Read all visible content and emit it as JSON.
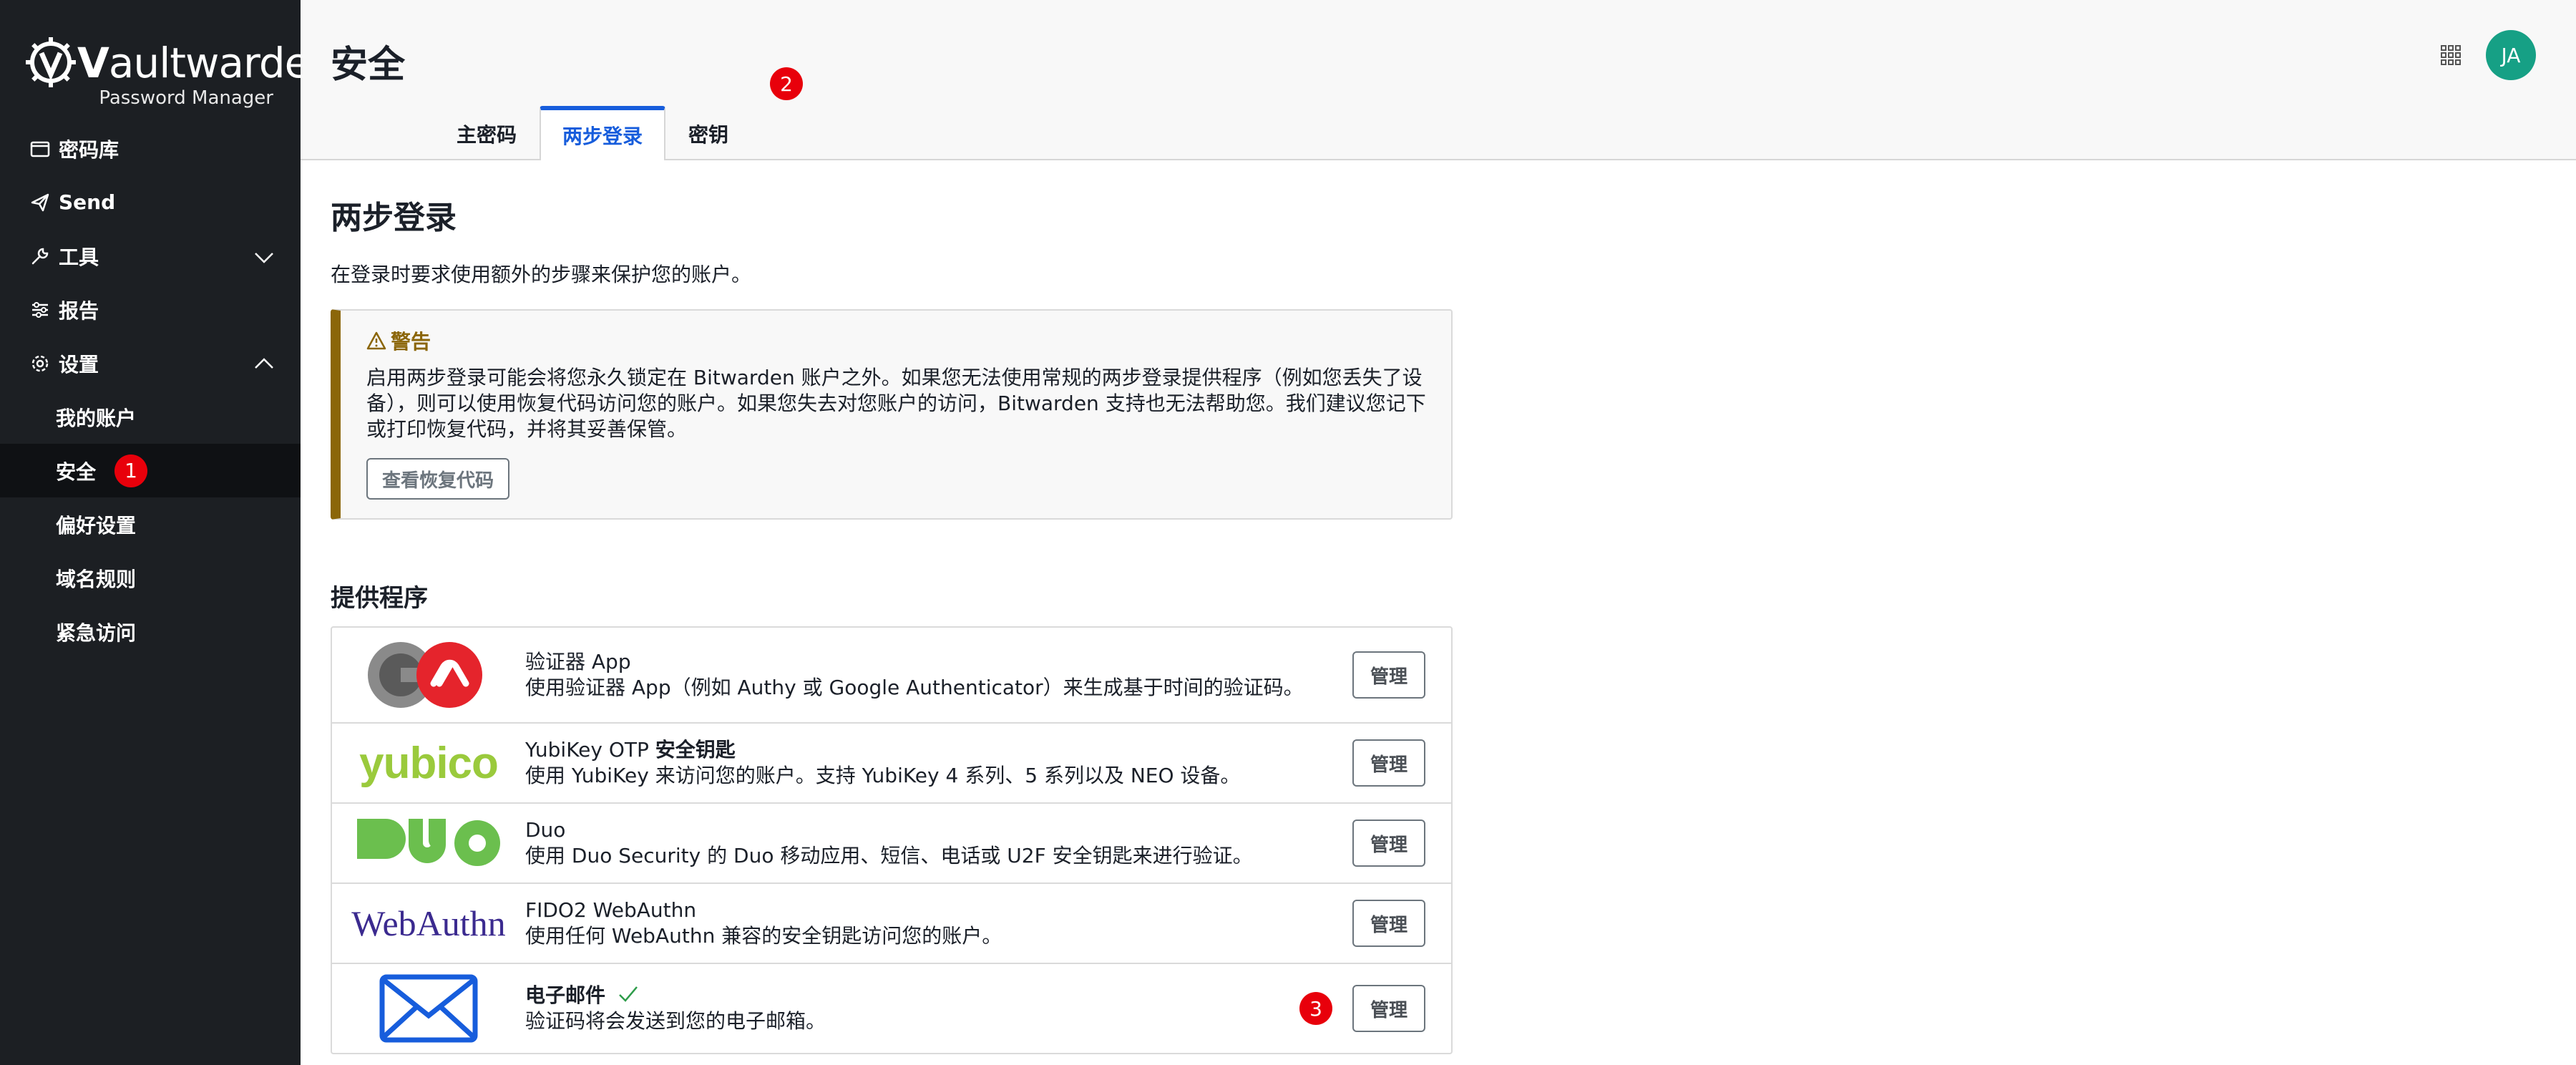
{
  "sidebar": {
    "brand": {
      "name_bold": "V",
      "name_rest": "aultwarden",
      "subtitle": "Password Manager"
    },
    "items": [
      {
        "label": "密码库",
        "icon": "vault-icon"
      },
      {
        "label": "Send",
        "icon": "send-icon"
      },
      {
        "label": "工具",
        "icon": "wrench-icon",
        "expanded": false
      },
      {
        "label": "报告",
        "icon": "sliders-icon"
      },
      {
        "label": "设置",
        "icon": "gear-icon",
        "expanded": true
      }
    ],
    "settings_sub": [
      {
        "label": "我的账户"
      },
      {
        "label": "安全",
        "active": true,
        "badge": "1"
      },
      {
        "label": "偏好设置"
      },
      {
        "label": "域名规则"
      },
      {
        "label": "紧急访问"
      }
    ]
  },
  "header": {
    "title": "安全",
    "avatar_initials": "JA",
    "tabs": [
      {
        "label": "主密码"
      },
      {
        "label": "两步登录",
        "active": true
      },
      {
        "label": "密钥"
      }
    ],
    "tab_badge": "2"
  },
  "content": {
    "title": "两步登录",
    "description": "在登录时要求使用额外的步骤来保护您的账户。",
    "warning": {
      "title": "警告",
      "text": "启用两步登录可能会将您永久锁定在 Bitwarden 账户之外。如果您无法使用常规的两步登录提供程序（例如您丢失了设备），则可以使用恢复代码访问您的账户。如果您失去对您账户的访问，Bitwarden 支持也无法帮助您。我们建议您记下或打印恢复代码，并将其妥善保管。",
      "button": "查看恢复代码"
    },
    "providers_title": "提供程序",
    "providers": [
      {
        "name": "验证器 App",
        "name_bold": "",
        "desc": "使用验证器 App（例如 Authy 或 Google Authenticator）来生成基于时间的验证码。",
        "logo": "authenticator-logo",
        "button": "管理"
      },
      {
        "name": "YubiKey OTP ",
        "name_bold": "安全钥匙",
        "desc": "使用 YubiKey 来访问您的账户。支持 YubiKey 4 系列、5 系列以及 NEO 设备。",
        "logo": "yubico-logo",
        "logo_text": "yubico",
        "button": "管理"
      },
      {
        "name": "Duo",
        "name_bold": "",
        "desc": "使用 Duo Security 的 Duo 移动应用、短信、电话或 U2F 安全钥匙来进行验证。",
        "logo": "duo-logo",
        "button": "管理"
      },
      {
        "name": "FIDO2 WebAuthn",
        "name_bold": "",
        "desc": "使用任何 WebAuthn 兼容的安全钥匙访问您的账户。",
        "logo": "webauthn-logo",
        "logo_text": "WebAuthn",
        "button": "管理"
      },
      {
        "name": "",
        "name_bold": "电子邮件",
        "desc": "验证码将会发送到您的电子邮箱。",
        "logo": "email-logo",
        "enabled": true,
        "badge": "3",
        "button": "管理"
      }
    ]
  },
  "colors": {
    "accent": "#175ddc",
    "sidebar_bg": "#1c1f23",
    "warning": "#8b6609",
    "badge": "#e8000b",
    "avatar": "#16a085"
  }
}
